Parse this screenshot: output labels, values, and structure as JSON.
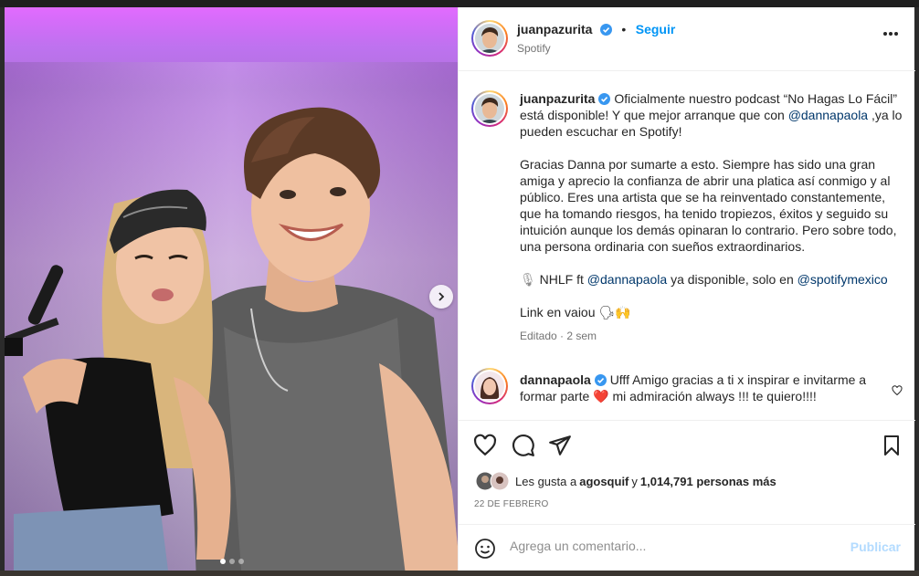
{
  "post": {
    "username": "juanpazurita",
    "follow_label": "Seguir",
    "separator": "•",
    "location": "Spotify"
  },
  "caption": {
    "username": "juanpazurita",
    "p1_a": "Oficialmente nuestro podcast “No Hagas Lo Fácil” está disponible! Y que mejor arranque que con ",
    "p1_mention": "@dannapaola",
    "p1_b": " ,ya lo pueden escuchar en Spotify!",
    "p2": "Gracias Danna por sumarte a esto. Siempre has sido una gran amiga y aprecio la confianza de abrir una platica así conmigo y al público. Eres una artista que se ha reinventado constantemente, que ha tomando riesgos, ha tenido tropiezos, éxitos y seguido su intuición aunque los demás opinaran lo contrario. Pero sobre todo, una persona ordinaria con sueños extraordinarios.",
    "p3_icon": "🎙",
    "p3_a": " NHLF ft ",
    "p3_mention1": "@dannapaola",
    "p3_b": " ya disponible, solo en ",
    "p3_mention2": "@spotifymexico",
    "p4_text": "Link en vaiou ",
    "p4_emoji": "🗣🙌",
    "meta": "Editado · 2 sem"
  },
  "comment": {
    "username": "dannapaola",
    "text_a": "Ufff Amigo gracias a ti x inspirar e invitarme a formar parte ",
    "heart": "❤️",
    "text_b": " mi admiración always !!! te quiero!!!!"
  },
  "likes": {
    "prefix": "Les gusta a ",
    "user": "agosquif",
    "middle": " y ",
    "count": "1,014,791 personas más"
  },
  "date": "22 DE FEBRERO",
  "add_comment": {
    "placeholder": "Agrega un comentario...",
    "post_label": "Publicar"
  },
  "carousel": {
    "slides": 3,
    "active": 1
  },
  "colors": {
    "accent": "#0095f6",
    "heart": "#ed4956",
    "disabled_post": "#b3dbff"
  }
}
